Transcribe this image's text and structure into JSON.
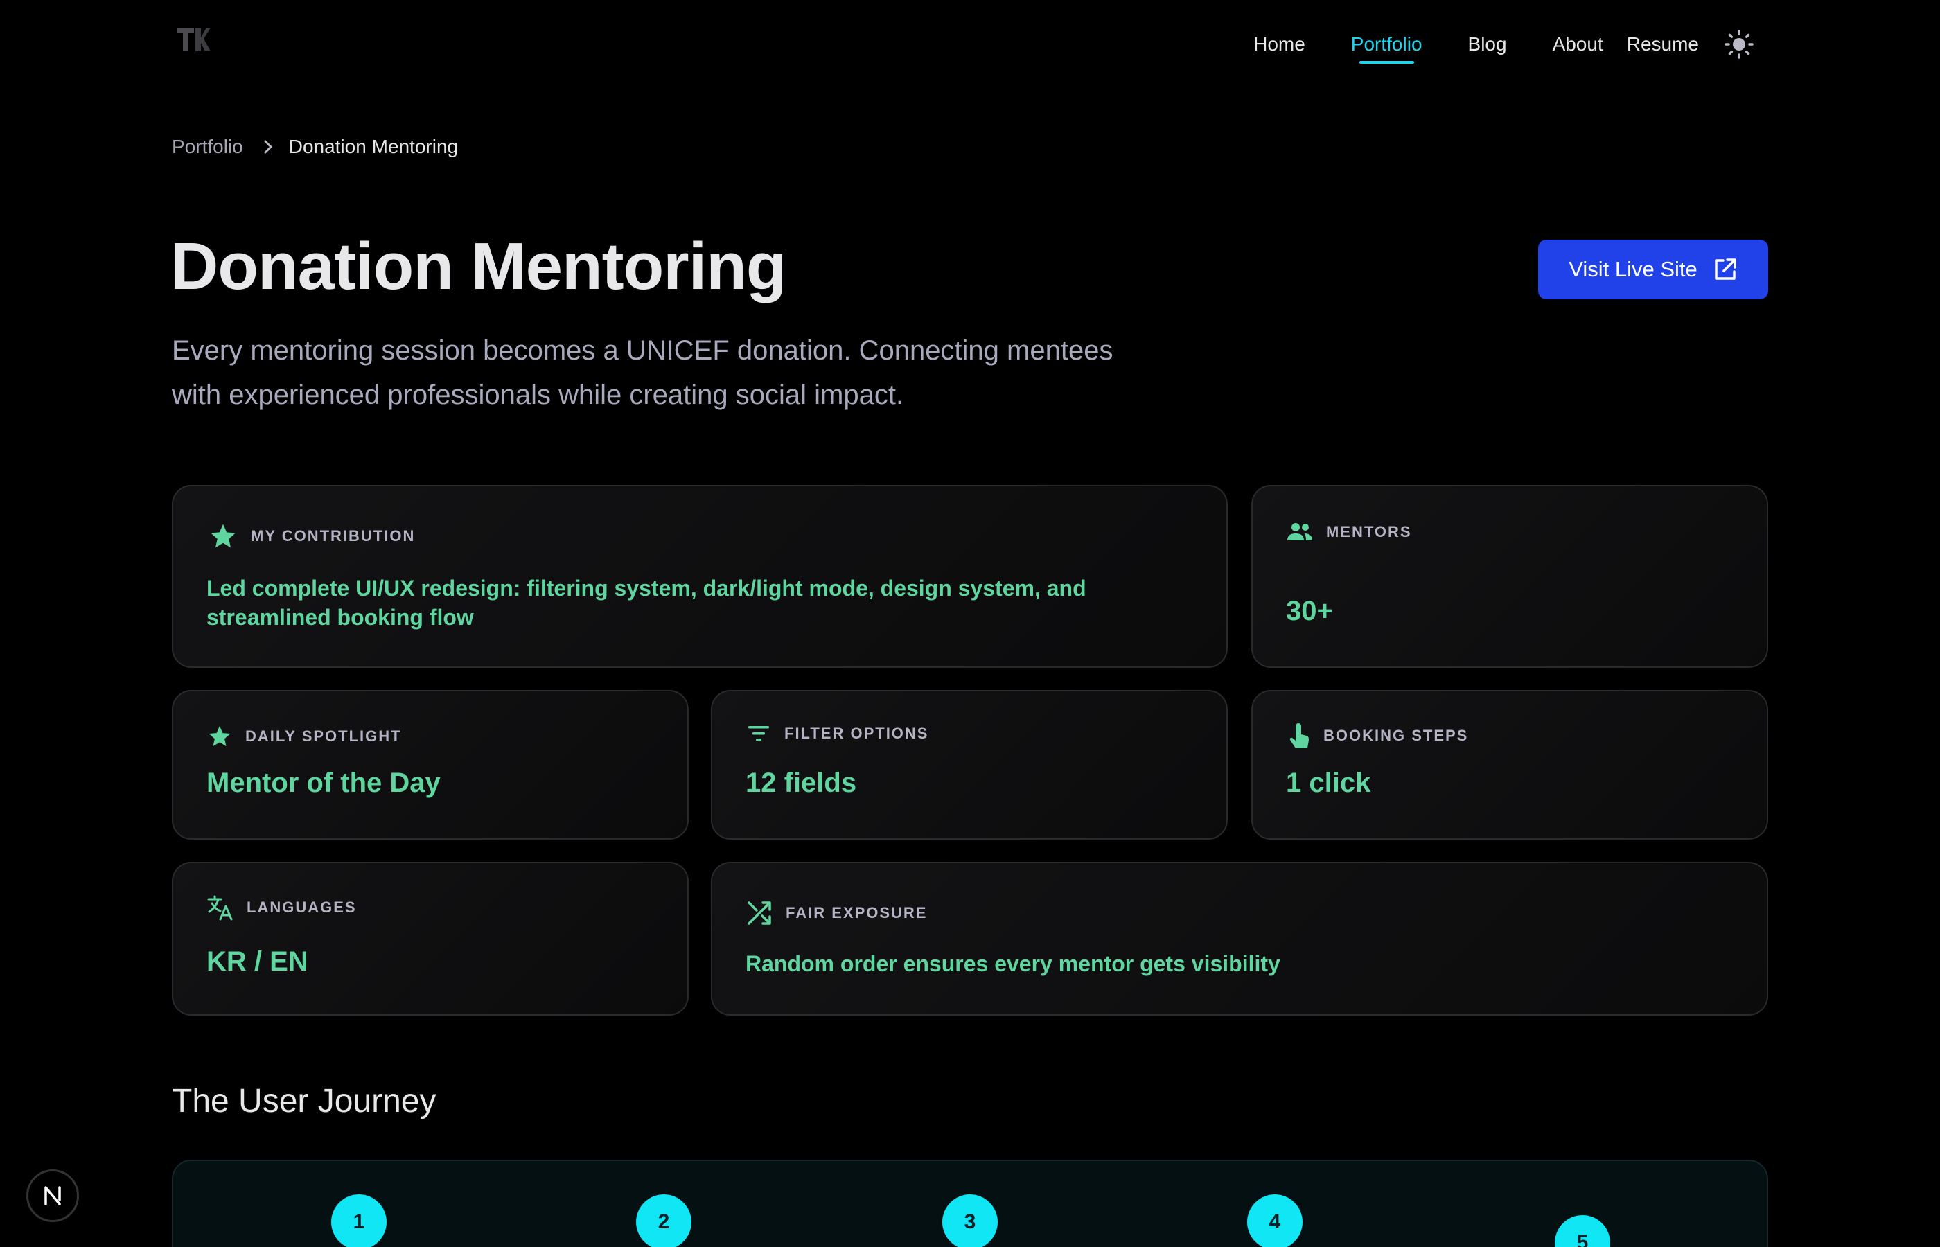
{
  "nav": {
    "items": [
      {
        "label": "Home"
      },
      {
        "label": "Portfolio"
      },
      {
        "label": "Blog"
      },
      {
        "label": "About"
      },
      {
        "label": "Resume"
      }
    ],
    "active_index": 1,
    "theme_icon": "sun-icon"
  },
  "breadcrumb": {
    "parent": "Portfolio",
    "current": "Donation Mentoring"
  },
  "hero": {
    "title": "Donation Mentoring",
    "subtitle": "Every mentoring session becomes a UNICEF donation. Connecting mentees with experienced professionals while creating social impact.",
    "cta_label": "Visit Live Site"
  },
  "cards": {
    "contribution": {
      "label": "MY CONTRIBUTION",
      "value": "Led complete UI/UX redesign: filtering system, dark/light mode, design system, and streamlined booking flow"
    },
    "mentors": {
      "label": "MENTORS",
      "value": "30+"
    },
    "spotlight": {
      "label": "DAILY SPOTLIGHT",
      "value": "Mentor of the Day"
    },
    "filters": {
      "label": "FILTER OPTIONS",
      "value": "12 fields"
    },
    "booking": {
      "label": "BOOKING STEPS",
      "value": "1 click"
    },
    "languages": {
      "label": "LANGUAGES",
      "value": "KR / EN"
    },
    "exposure": {
      "label": "FAIR EXPOSURE",
      "value": "Random order ensures every mentor gets visibility"
    }
  },
  "journey": {
    "title": "The User Journey",
    "steps": [
      "1",
      "2",
      "3",
      "4",
      "5"
    ]
  },
  "colors": {
    "accent_cyan": "#22d3ee",
    "accent_green": "#5fd6a0",
    "button_blue": "#2042e8"
  }
}
